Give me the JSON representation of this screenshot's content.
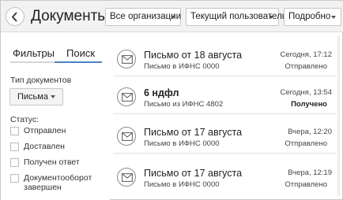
{
  "header": {
    "title": "Документы",
    "filters": [
      {
        "label": "Все организации"
      },
      {
        "label": "Текущий пользователь"
      },
      {
        "label": "Подробно"
      }
    ]
  },
  "sidebar": {
    "tabs": [
      {
        "label": "Фильтры",
        "active": false
      },
      {
        "label": "Поиск",
        "active": true
      }
    ],
    "doc_type_label": "Тип документов",
    "doc_type_value": "Письма",
    "status_label": "Статус:",
    "statuses": [
      {
        "label": "Отправлен",
        "checked": false
      },
      {
        "label": "Доставлен",
        "checked": false
      },
      {
        "label": "Получен ответ",
        "checked": false
      },
      {
        "label": "Документооборот завершен",
        "checked": false
      }
    ]
  },
  "documents": [
    {
      "icon": "envelope-icon",
      "title": "Письмо от 18 августа",
      "subtitle": "Письмо в ИФНС 0000",
      "date": "Сегодня, 17:12",
      "status": "Отправлено",
      "unread": false
    },
    {
      "icon": "envelope-icon",
      "title": "6 ндфл",
      "subtitle": "Письмо из ИФНС 4802",
      "date": "Сегодня, 13:54",
      "status": "Получено",
      "unread": true
    },
    {
      "icon": "envelope-icon",
      "title": "Письмо от 17 августа",
      "subtitle": "Письмо в ИФНС 0000",
      "date": "Вчера, 12:20",
      "status": "Отправлено",
      "unread": false
    },
    {
      "icon": "envelope-icon",
      "title": "Письмо от 17 августа",
      "subtitle": "Письмо в ИФНС 0000",
      "date": "Вчера, 12:19",
      "status": "Отправлено",
      "unread": false
    }
  ],
  "colors": {
    "accent": "#4a82c0",
    "header_bg": "#f2f2f2",
    "border": "#c6c6c6"
  }
}
